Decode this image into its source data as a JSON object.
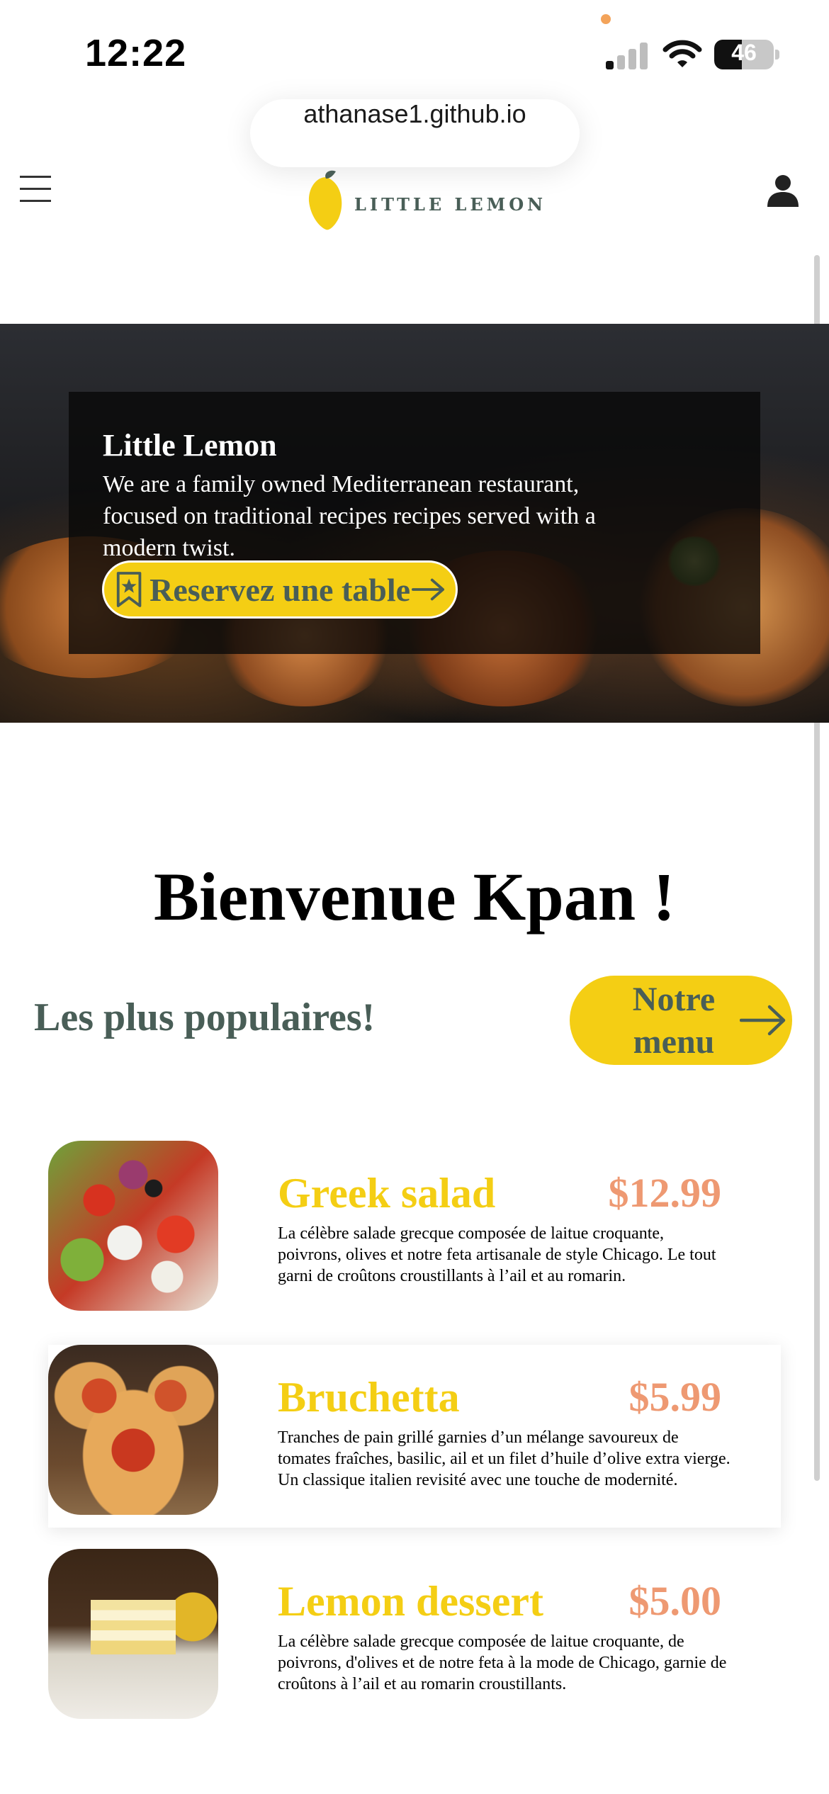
{
  "status_bar": {
    "time": "12:22",
    "battery": "46",
    "battery_level": 0.46
  },
  "browser": {
    "url": "athanase1.github.io"
  },
  "nav": {
    "brand": "LITTLE LEMON"
  },
  "hero": {
    "title": "Little Lemon",
    "description": "We are a family owned Mediterranean restaurant, focused on traditional recipes recipes served with a modern twist.",
    "reserve_label": "Reservez une table"
  },
  "welcome": "Bienvenue Kpan !",
  "popular": {
    "heading": "Les plus populaires!",
    "menu_button_label": "Notre menu"
  },
  "dishes": [
    {
      "name": "Greek salad",
      "price": "$12.99",
      "description": "La célèbre salade grecque composée de laitue croquante, poivrons, olives et notre feta artisanale de style Chicago. Le tout garni de croûtons croustillants à l’ail et au romarin."
    },
    {
      "name": "Bruchetta",
      "price": "$5.99",
      "description": "Tranches de pain grillé garnies d’un mélange savoureux de tomates fraîches, basilic, ail et un filet d’huile d’olive extra vierge. Un classique italien revisité avec une touche de modernité."
    },
    {
      "name": "Lemon dessert",
      "price": "$5.00",
      "description": "La célèbre salade grecque composée de laitue croquante, de poivrons, d'olives et de notre feta à la mode de Chicago, garnie de croûtons à l’ail et au romarin croustillants."
    }
  ],
  "colors": {
    "primary_green": "#495e57",
    "primary_yellow": "#f4ce14",
    "price_salmon": "#ee9972"
  }
}
